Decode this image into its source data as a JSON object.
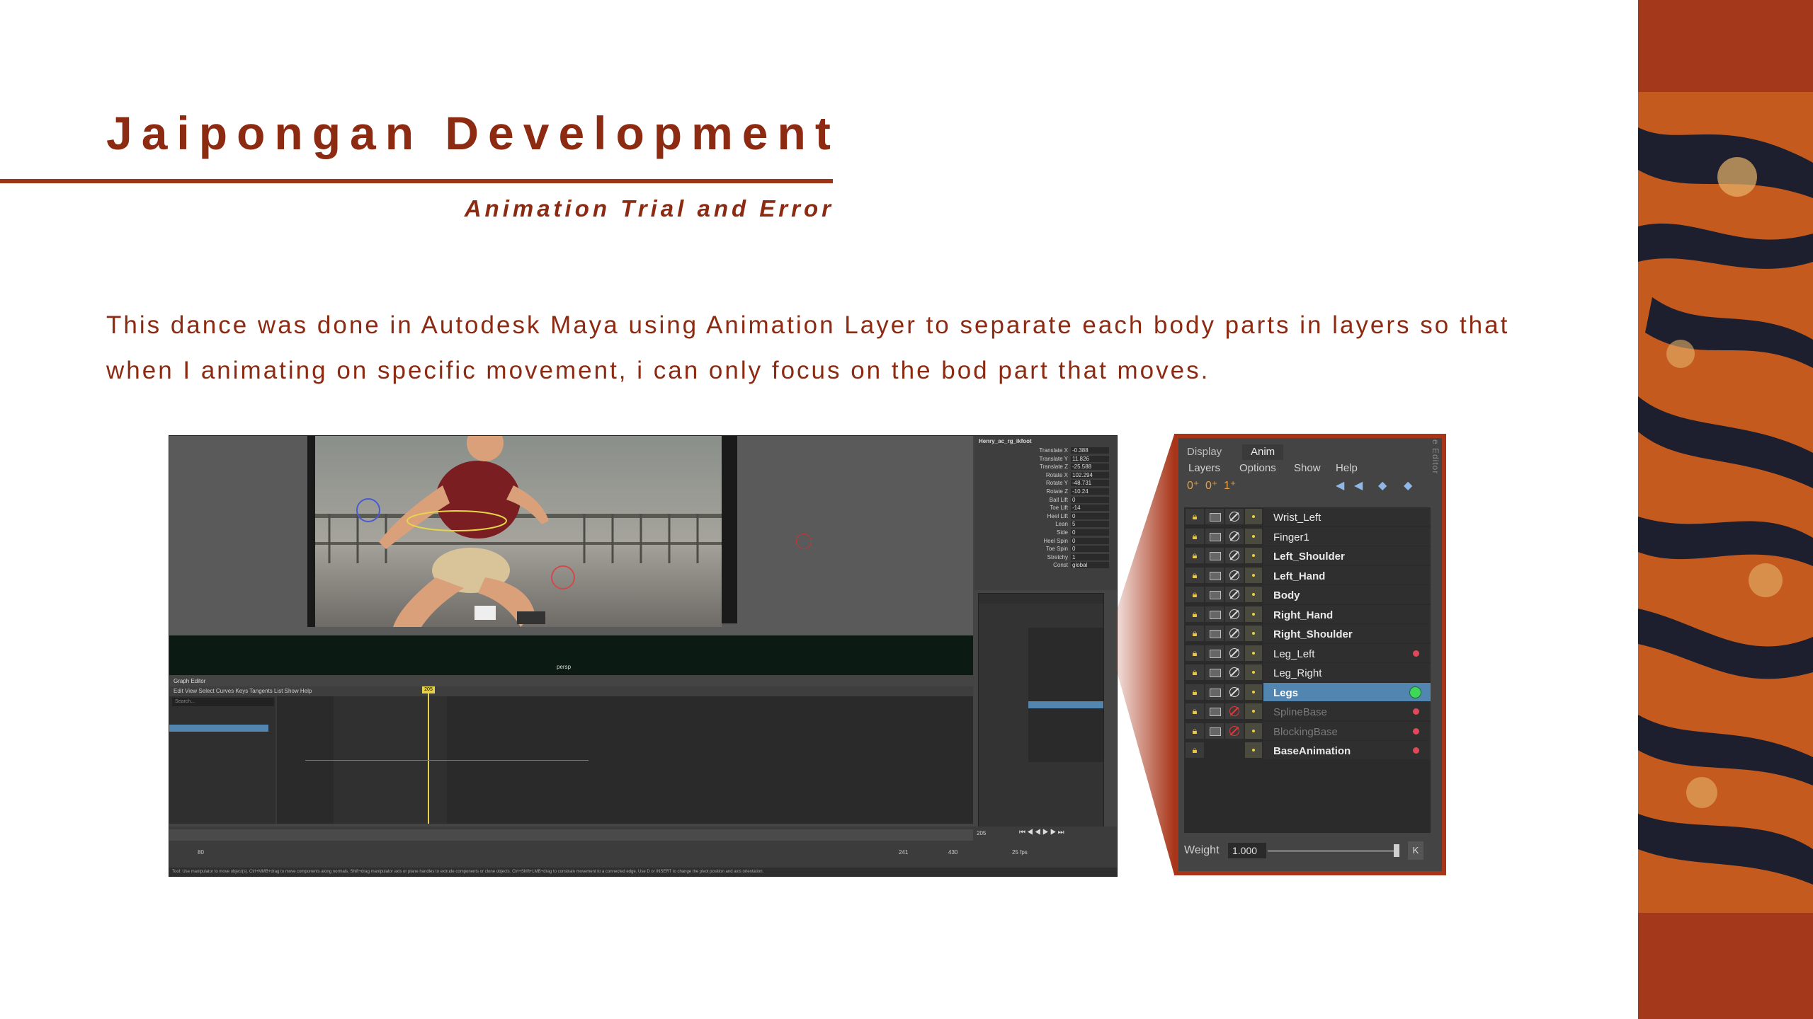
{
  "slide": {
    "title": "Jaipongan Development",
    "subtitle": "Animation Trial and Error",
    "paragraph_lines": [
      "This dance was done in Autodesk Maya using Animation Layer to separate each body parts in layers so that",
      "when I animating on specific movement, i can only focus on the bod part that moves."
    ]
  },
  "colors": {
    "accent": "#8c2a12",
    "batik_base": "#a3391a",
    "panel_selected": "#5286b0"
  },
  "maya": {
    "node_name": "Henry_ac_rg_ikfoot",
    "attributes": [
      {
        "label": "Translate X",
        "value": "-0.388"
      },
      {
        "label": "Translate Y",
        "value": "11.826"
      },
      {
        "label": "Translate Z",
        "value": "-25.588"
      },
      {
        "label": "Rotate X",
        "value": "102.294"
      },
      {
        "label": "Rotate Y",
        "value": "-48.731"
      },
      {
        "label": "Rotate Z",
        "value": "-10.24"
      },
      {
        "label": "Ball Lift",
        "value": "0"
      },
      {
        "label": "Toe Lift",
        "value": "-14"
      },
      {
        "label": "Heel Lift",
        "value": "0"
      },
      {
        "label": "Lean",
        "value": "5"
      },
      {
        "label": "Side",
        "value": "0"
      },
      {
        "label": "Heel Spin",
        "value": "0"
      },
      {
        "label": "Toe Spin",
        "value": "0"
      },
      {
        "label": "Stretchy",
        "value": "1"
      },
      {
        "label": "Const",
        "value": "global"
      }
    ],
    "viewport_label": "persp",
    "graph_editor_title": "Graph Editor",
    "graph_editor_menu": "Edit   View   Select   Curves   Keys   Tangents   List   Show   Help",
    "graph_search_placeholder": "Search...",
    "current_frame": "205",
    "range_start": "80",
    "range_end": "241",
    "end_frame": "430",
    "fps": "25 fps",
    "help_text": "Tool: Use manipulator to move object(s). Ctrl+MMB+drag to move components along normals. Shift+drag manipulator axis or plane handles to extrude components or clone objects. Ctrl+Shift+LMB+drag to constrain movement to a connected edge. Use D or INSERT to change the pivot position and axis orientation."
  },
  "anim_panel": {
    "tabs": [
      "Display",
      "Anim"
    ],
    "active_tab": "Anim",
    "menu": [
      "Layers",
      "Options",
      "Show",
      "Help"
    ],
    "side_label": "e Editor",
    "layers": [
      {
        "name": "Wrist_Left",
        "state": "normal",
        "dot": "none"
      },
      {
        "name": "Finger1",
        "state": "normal",
        "dot": "none"
      },
      {
        "name": "Left_Shoulder",
        "state": "bold",
        "dot": "none"
      },
      {
        "name": "Left_Hand",
        "state": "bold",
        "dot": "none"
      },
      {
        "name": "Body",
        "state": "bold",
        "dot": "none"
      },
      {
        "name": "Right_Hand",
        "state": "bold",
        "dot": "none"
      },
      {
        "name": "Right_Shoulder",
        "state": "bold",
        "dot": "none"
      },
      {
        "name": "Leg_Left",
        "state": "normal",
        "dot": "red"
      },
      {
        "name": "Leg_Right",
        "state": "normal",
        "dot": "none"
      },
      {
        "name": "Legs",
        "state": "selected",
        "dot": "green"
      },
      {
        "name": "SplineBase",
        "state": "dim",
        "dot": "red"
      },
      {
        "name": "BlockingBase",
        "state": "dim",
        "dot": "red"
      },
      {
        "name": "BaseAnimation",
        "state": "bold",
        "dot": "red"
      }
    ],
    "weight_label": "Weight",
    "weight_value": "1.000",
    "weight_key": "K"
  }
}
